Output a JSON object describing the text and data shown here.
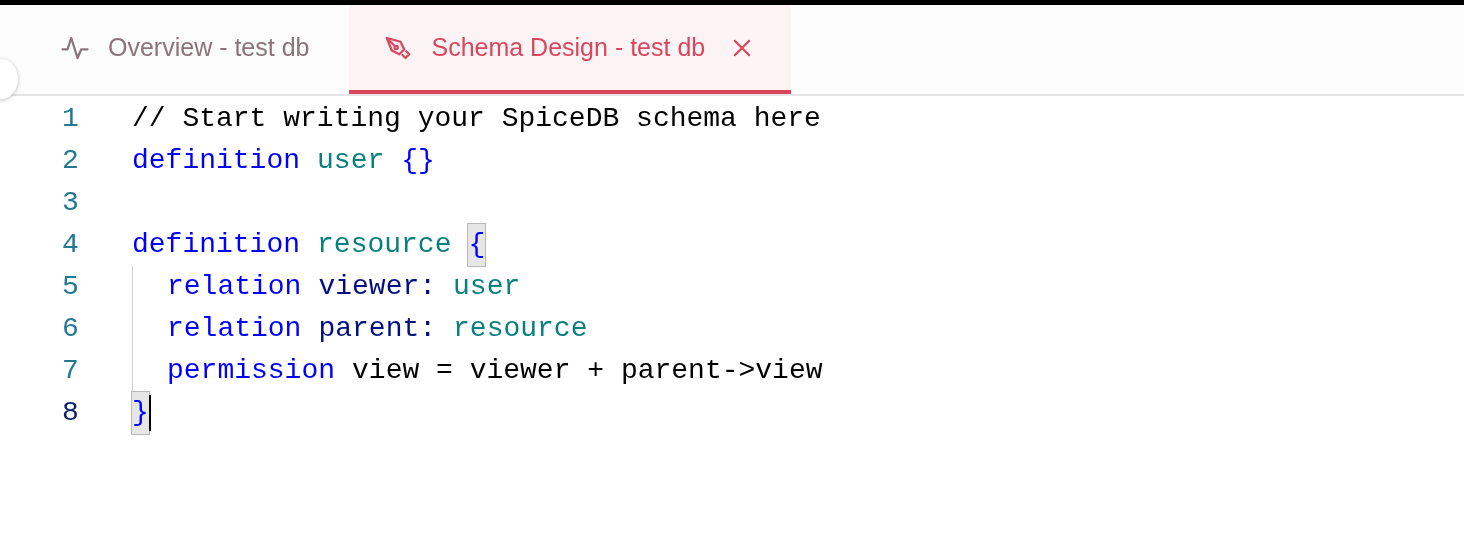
{
  "tabs": [
    {
      "label": "Overview - test db",
      "selected": false,
      "closable": false
    },
    {
      "label": "Schema Design - test db",
      "selected": true,
      "closable": true
    }
  ],
  "editor": {
    "lines": [
      {
        "number": "1",
        "current": false,
        "guide": false,
        "tokens": [
          {
            "kind": "comment",
            "text": "// Start writing your SpiceDB schema here"
          }
        ]
      },
      {
        "number": "2",
        "current": false,
        "guide": false,
        "tokens": [
          {
            "kind": "keyword",
            "text": "definition"
          },
          {
            "kind": "type",
            "text": "user"
          },
          {
            "kind": "brace",
            "text": "{}"
          }
        ]
      },
      {
        "number": "3",
        "current": false,
        "guide": false
      },
      {
        "number": "4",
        "current": false,
        "guide": false,
        "tokens": [
          {
            "kind": "keyword",
            "text": "definition"
          },
          {
            "kind": "type",
            "text": "resource"
          },
          {
            "kind": "matched-brace",
            "text": "{"
          }
        ]
      },
      {
        "number": "5",
        "current": false,
        "guide": true,
        "tokens": [
          {
            "kind": "keyword",
            "text": "relation"
          },
          {
            "kind": "name",
            "text": "viewer:"
          },
          {
            "kind": "type",
            "text": "user"
          }
        ]
      },
      {
        "number": "6",
        "current": false,
        "guide": true,
        "tokens": [
          {
            "kind": "keyword",
            "text": "relation"
          },
          {
            "kind": "name",
            "text": "parent:"
          },
          {
            "kind": "type",
            "text": "resource"
          }
        ]
      },
      {
        "number": "7",
        "current": false,
        "guide": true,
        "tokens": [
          {
            "kind": "keyword",
            "text": "permission"
          },
          {
            "kind": "plain",
            "text": "view = viewer + parent->view"
          }
        ]
      },
      {
        "number": "8",
        "current": true,
        "guide": false,
        "tokens": [
          {
            "kind": "matched-brace",
            "text": "}"
          }
        ]
      }
    ]
  }
}
